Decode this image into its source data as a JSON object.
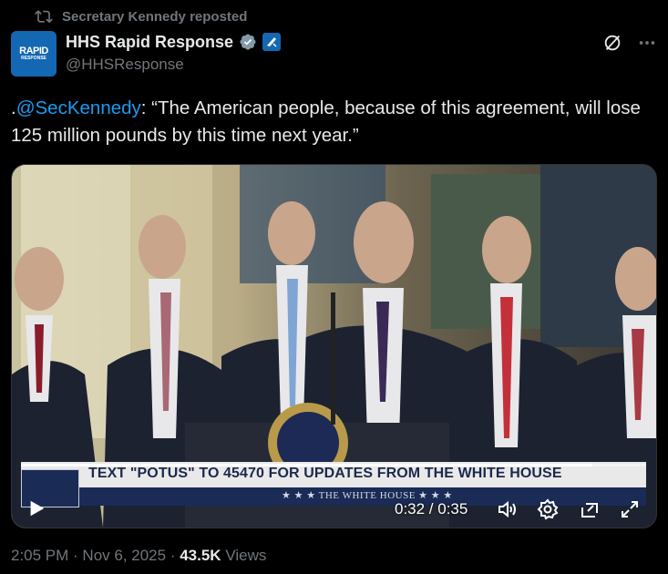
{
  "repost": {
    "text": "Secretary Kennedy reposted"
  },
  "author": {
    "name": "HHS Rapid Response",
    "handle": "@HHSResponse",
    "avatar_text": "RAPID",
    "avatar_subtext": "RESPONSE"
  },
  "tweet": {
    "prefix": ".",
    "mention": "@SecKennedy",
    "body": ": “The American people, because of this agreement, will lose 125 million pounds by this time next year.”"
  },
  "video": {
    "chyron": "TEXT \"POTUS\" TO 45470 FOR UPDATES FROM THE WHITE HOUSE",
    "sub_chyron": "★ ★ ★   THE WHITE HOUSE   ★ ★ ★",
    "time": "0:32 / 0:35",
    "progress": 0.914
  },
  "footer": {
    "time": "2:05 PM",
    "sep1": " · ",
    "date": "Nov 6, 2025",
    "sep2": " · ",
    "views": "43.5K",
    "views_label": " Views"
  },
  "colors": {
    "accent": "#1d9bf0",
    "muted": "#71767b",
    "text": "#e7e9ea",
    "bg": "#000000"
  },
  "icons": [
    "repost-icon",
    "verified-badge-icon",
    "government-badge-icon",
    "grok-icon",
    "more-icon",
    "play-icon",
    "volume-icon",
    "settings-icon",
    "pip-icon",
    "fullscreen-icon"
  ]
}
